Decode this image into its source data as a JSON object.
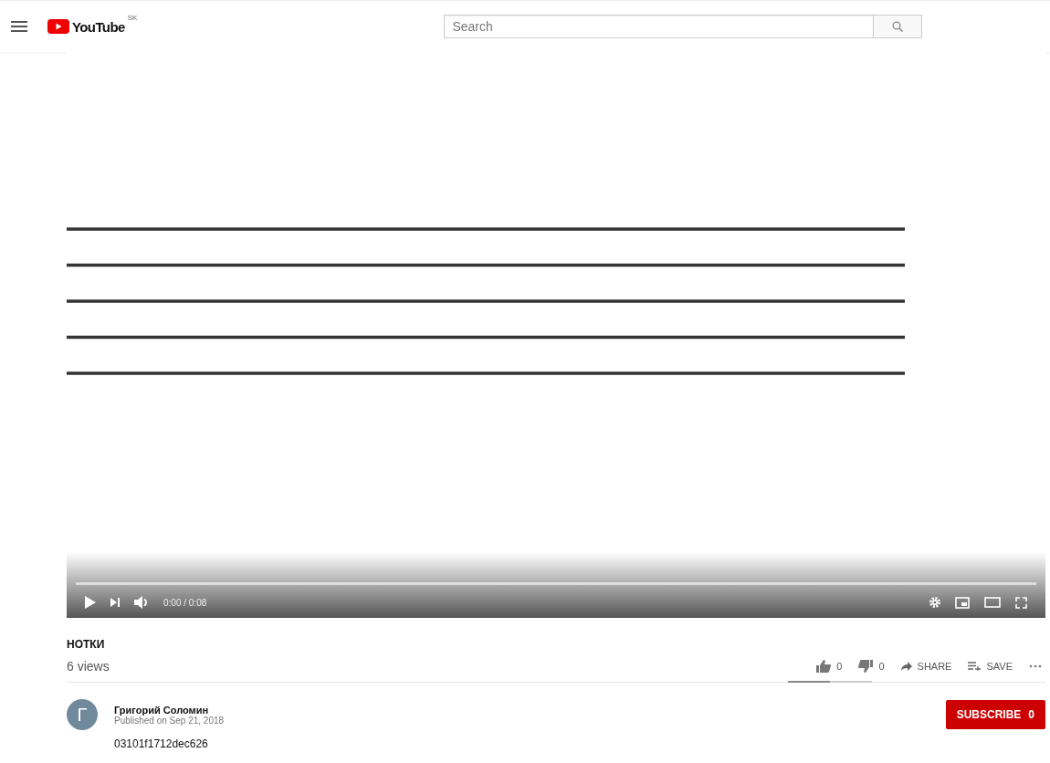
{
  "header": {
    "logo_text": "YouTube",
    "region": "SK",
    "search": {
      "placeholder": "Search"
    }
  },
  "player": {
    "time": "0:00 / 0:08"
  },
  "video": {
    "title": "НОТКИ",
    "views": "6 views",
    "likes": "0",
    "dislikes": "0",
    "sentiment": {
      "level": 0.5
    },
    "actions": [
      {
        "kind": "share",
        "label": "SHARE"
      },
      {
        "kind": "save",
        "label": "SAVE"
      }
    ]
  },
  "channel": {
    "avatar_letter": "Г",
    "name": "Григорий Соломин",
    "published": "Published on Sep 21, 2018",
    "subscribe": {
      "label": "SUBSCRIBE",
      "count": "0"
    }
  },
  "description": "03101f1712dec626"
}
